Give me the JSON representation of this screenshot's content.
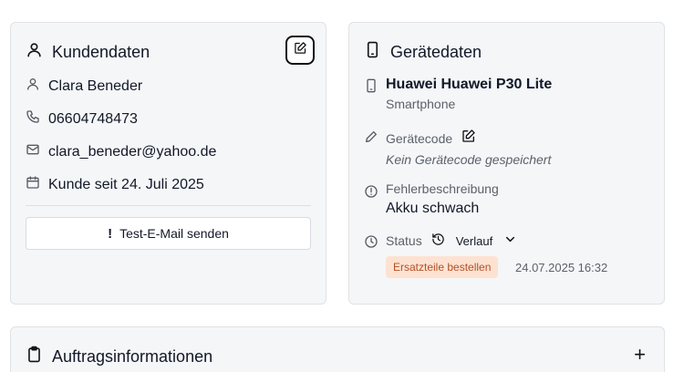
{
  "customer": {
    "title": "Kundendaten",
    "name": "Clara Beneder",
    "phone": "06604748473",
    "email": "clara_beneder@yahoo.de",
    "since": "Kunde seit 24. Juli 2025",
    "mail_button": "Test-E-Mail senden",
    "mail_button_icon": "!"
  },
  "device": {
    "title": "Gerätedaten",
    "name": "Huawei Huawei P30 Lite",
    "type": "Smartphone",
    "code_label": "Gerätecode",
    "code_value": "Kein Gerätecode gespeichert",
    "fault_label": "Fehlerbeschreibung",
    "fault_value": "Akku schwach",
    "status_label": "Status",
    "history_label": "Verlauf",
    "status_badge": "Ersatzteile bestellen",
    "status_time": "24.07.2025 16:32"
  },
  "order": {
    "title": "Auftragsinformationen",
    "add_label": "+"
  }
}
